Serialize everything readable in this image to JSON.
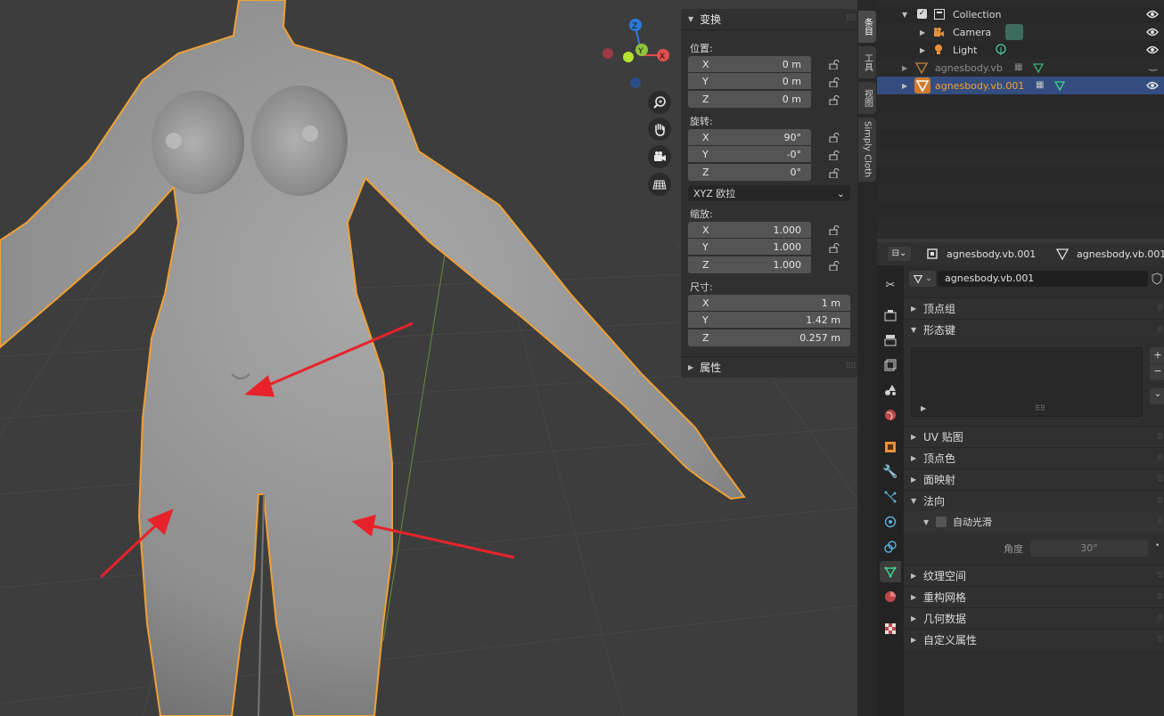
{
  "viewport": {
    "nav_buttons": [
      "zoom-icon",
      "hand-pan-icon",
      "camera-icon",
      "grid-icon"
    ],
    "gizmo": {
      "x_label": "X",
      "y_label": "Y",
      "z_label": "Z"
    }
  },
  "npanel": {
    "transform_title": "变换",
    "location_label": "位置:",
    "location": [
      {
        "axis": "X",
        "value": "0 m"
      },
      {
        "axis": "Y",
        "value": "0 m"
      },
      {
        "axis": "Z",
        "value": "0 m"
      }
    ],
    "rotation_label": "旋转:",
    "rotation": [
      {
        "axis": "X",
        "value": "90°"
      },
      {
        "axis": "Y",
        "value": "-0°"
      },
      {
        "axis": "Z",
        "value": "0°"
      }
    ],
    "rotation_mode": "XYZ 欧拉",
    "scale_label": "缩放:",
    "scale": [
      {
        "axis": "X",
        "value": "1.000"
      },
      {
        "axis": "Y",
        "value": "1.000"
      },
      {
        "axis": "Z",
        "value": "1.000"
      }
    ],
    "dimensions_label": "尺寸:",
    "dimensions": [
      {
        "axis": "X",
        "value": "1 m"
      },
      {
        "axis": "Y",
        "value": "1.42 m"
      },
      {
        "axis": "Z",
        "value": "0.257 m"
      }
    ],
    "properties_title": "属性"
  },
  "vtabs": [
    "条目",
    "工具",
    "视图",
    "Simply Cloth"
  ],
  "outliner": {
    "rows": [
      {
        "label": "Collection"
      },
      {
        "label": "Camera"
      },
      {
        "label": "Light"
      },
      {
        "label": "agnesbody.vb"
      },
      {
        "label": "agnesbody.vb.001"
      }
    ]
  },
  "properties": {
    "header_object": "agnesbody.vb.001",
    "header_mesh": "agnesbody.vb.001",
    "mesh_name": "agnesbody.vb.001",
    "panels": {
      "vertex_groups": "顶点组",
      "shape_keys": "形态键",
      "uv_maps": "UV 贴图",
      "vertex_colors": "顶点色",
      "face_maps": "面映射",
      "normals": "法向",
      "auto_smooth": "自动光滑",
      "angle_label": "角度",
      "angle_value": "30°",
      "texture_space": "纹理空间",
      "remesh": "重构网格",
      "geometry_data": "几何数据",
      "custom_props": "自定义属性"
    }
  },
  "colors": {
    "accent_orange": "#f0a035",
    "selection_blue": "#334d80",
    "arrow_red": "#e8222a",
    "mesh_gray": "#9a9a9a"
  }
}
